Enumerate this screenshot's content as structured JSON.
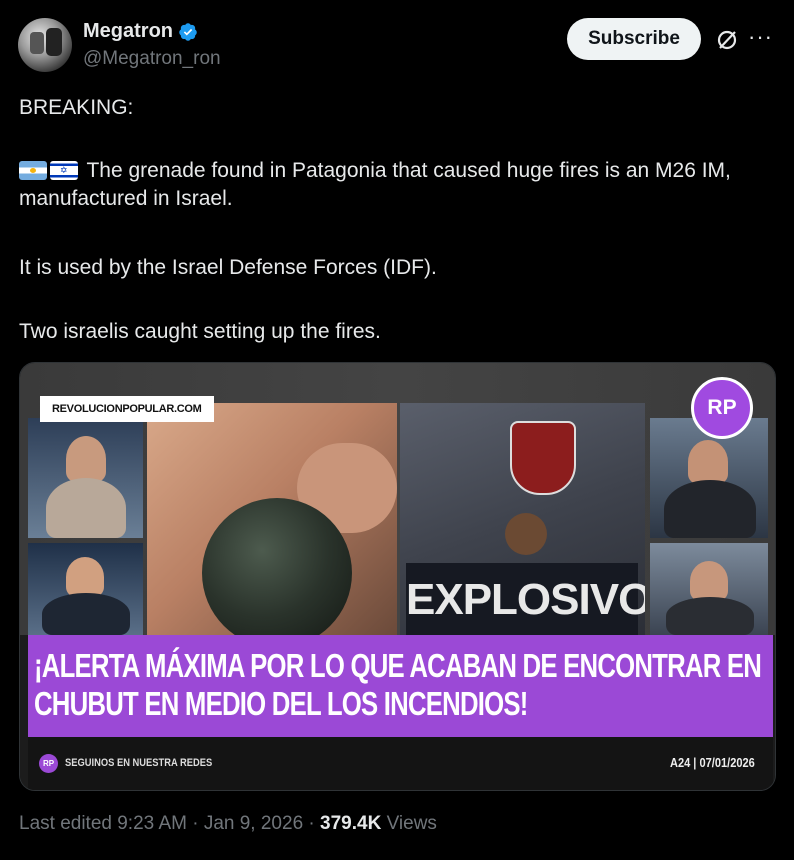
{
  "author": {
    "display_name": "Megatron",
    "handle": "@Megatron_ron",
    "verified": true
  },
  "actions": {
    "subscribe_label": "Subscribe",
    "grok_icon": "grok-icon",
    "more_icon": "more-icon",
    "more_label": "···"
  },
  "tweet": {
    "line1": "BREAKING:",
    "line2": "The grenade found in Patagonia that caused huge fires is an M26 IM, manufactured in Israel.",
    "flags": [
      "argentina-flag",
      "israel-flag"
    ],
    "line3": "It is used by the Israel Defense Forces (IDF).",
    "line4": "Two israelis caught setting up the fires."
  },
  "media": {
    "site_badge": "REVOLUCIONPOPULAR.COM",
    "logo_text": "RP",
    "explosivos": "EXPLOSIVOS",
    "headline": "¡ALERTA MÁXIMA POR LO QUE ACABAN DE ENCONTRAR EN CHUBUT EN MEDIO DEL LOS INCENDIOS!",
    "footer_logo": "RP",
    "footer_text": "SEGUINOS EN NUESTRA REDES",
    "channel_date": "A24 | 07/01/2026"
  },
  "meta": {
    "edited": "Last edited 9:23 AM · Jan 9, 2026 · ",
    "views_count": "379.4K",
    "views_label": " Views"
  },
  "colors": {
    "background": "#000000",
    "text": "#e7e9ea",
    "muted": "#71767b",
    "verified_blue": "#1d9bf0",
    "banner_purple": "#9b49d6"
  }
}
